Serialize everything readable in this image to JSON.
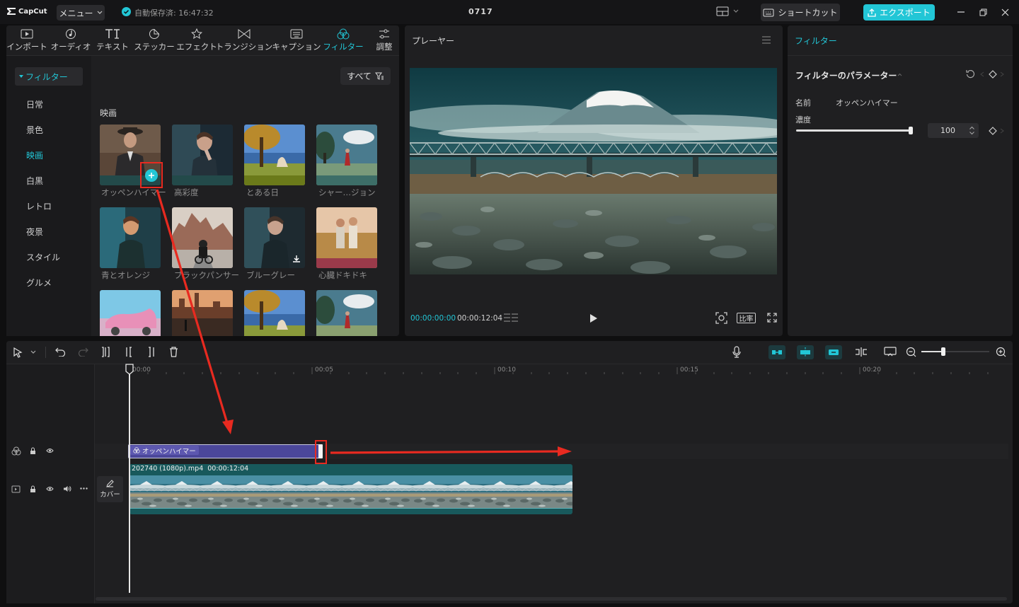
{
  "app": {
    "logo_text": "CapCut",
    "menu_label": "メニュー",
    "autosave_label": "自動保存済: 16:47:32",
    "project_title": "0717",
    "shortcut_label": "ショートカット",
    "export_label": "エクスポート"
  },
  "toolbar": {
    "tabs": [
      {
        "label": "インポート",
        "icon": "import-icon"
      },
      {
        "label": "オーディオ",
        "icon": "audio-icon"
      },
      {
        "label": "テキスト",
        "icon": "text-icon"
      },
      {
        "label": "ステッカー",
        "icon": "sticker-icon"
      },
      {
        "label": "エフェクト",
        "icon": "effect-icon"
      },
      {
        "label": "トランジション",
        "icon": "transition-icon"
      },
      {
        "label": "キャプション",
        "icon": "caption-icon"
      },
      {
        "label": "フィルター",
        "icon": "filter-icon"
      },
      {
        "label": "調整",
        "icon": "adjust-icon"
      }
    ],
    "active_tab": "フィルター"
  },
  "sidebar": {
    "header": "フィルター",
    "items": [
      {
        "label": "日常"
      },
      {
        "label": "景色"
      },
      {
        "label": "映画"
      },
      {
        "label": "白黒"
      },
      {
        "label": "レトロ"
      },
      {
        "label": "夜景"
      },
      {
        "label": "スタイル"
      },
      {
        "label": "グルメ"
      }
    ],
    "active_item": "映画"
  },
  "filters": {
    "all_label": "すべて",
    "section_title": "映画",
    "items": [
      {
        "label": "オッペンハイマー"
      },
      {
        "label": "高彩度"
      },
      {
        "label": "とある日"
      },
      {
        "label": "シャー…ジョン"
      },
      {
        "label": "青とオレンジ"
      },
      {
        "label": "ブラックパンサー"
      },
      {
        "label": "ブルーグレー"
      },
      {
        "label": "心臓ドキドキ"
      }
    ]
  },
  "player": {
    "title": "プレーヤー",
    "current_time": "00:00:00:00",
    "total_time": "00:00:12:04",
    "ratio_label": "比率"
  },
  "inspector": {
    "title": "フィルター",
    "section_title": "フィルターのパラメーター",
    "name_label": "名前",
    "name_value": "オッペンハイマー",
    "intensity_label": "濃度",
    "intensity_value": "100",
    "intensity_level": 1.0
  },
  "timeline": {
    "ruler": [
      "00:00",
      "00:05",
      "00:10",
      "00:15",
      "00:20"
    ],
    "filter_clip_label": "オッペンハイマー",
    "video_clip_name": "202740 (1080p).mp4",
    "video_clip_duration": "00:00:12:04",
    "cover_label": "カバー",
    "zoom_level": 0.35
  },
  "colors": {
    "accent": "#22c6d6",
    "filter_clip": "#4b479a",
    "video_clip": "#18595c",
    "annotation": "#e82a20"
  }
}
